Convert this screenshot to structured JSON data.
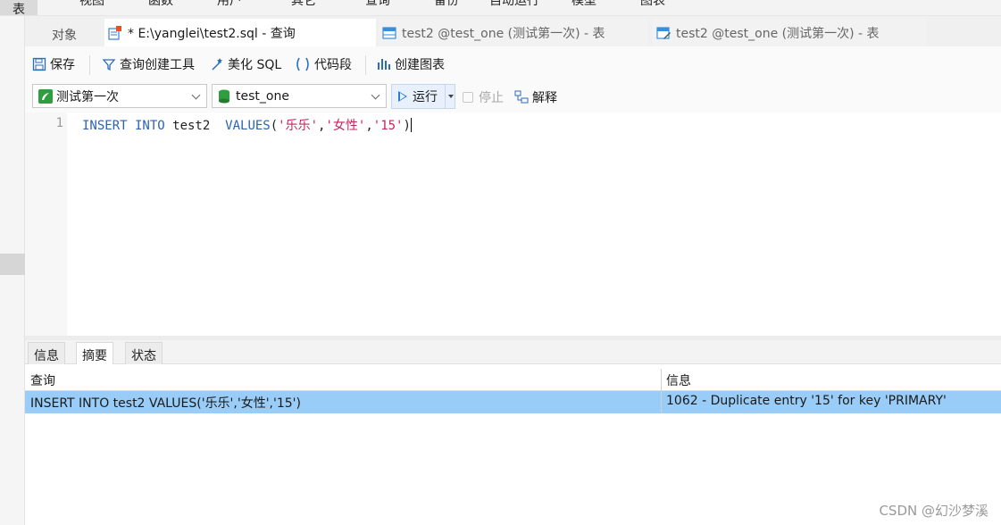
{
  "menu": {
    "items": [
      "表",
      "视图",
      "函数",
      "用户",
      "其它",
      "查询",
      "备份",
      "自动运行",
      "模型",
      "图表"
    ]
  },
  "tabs": {
    "objects_label": "对象",
    "active_label": "* E:\\yanglei\\test2.sql - 查询",
    "tab2_label": "test2 @test_one (测试第一次) - 表",
    "tab3_label": "test2 @test_one (测试第一次) - 表"
  },
  "toolbar": {
    "save": "保存",
    "query_builder": "查询创建工具",
    "beautify": "美化 SQL",
    "snippet": "代码段",
    "create_chart": "创建图表"
  },
  "selectors": {
    "connection": "测试第一次",
    "database": "test_one",
    "run": "运行",
    "stop": "停止",
    "explain": "解释"
  },
  "editor": {
    "line_number": "1",
    "code": {
      "kw1": "INSERT INTO",
      "t1": " test2  ",
      "kw2": "VALUES",
      "p1": "(",
      "s1": "'乐乐'",
      "c1": ",",
      "s2": "'女性'",
      "c2": ",",
      "s3": "'15'",
      "p2": ")"
    }
  },
  "results": {
    "tabs": [
      "信息",
      "摘要",
      "状态"
    ],
    "active_tab": "摘要",
    "columns": [
      "查询",
      "信息"
    ],
    "rows": [
      {
        "query": "INSERT INTO test2  VALUES('乐乐','女性','15')",
        "info": "1062 - Duplicate entry '15' for key 'PRIMARY'"
      }
    ]
  },
  "watermark": "CSDN @幻沙梦溪",
  "colors": {
    "selected_row": "#99cdf7",
    "keyword": "#2a62b8",
    "string": "#c8245b"
  }
}
